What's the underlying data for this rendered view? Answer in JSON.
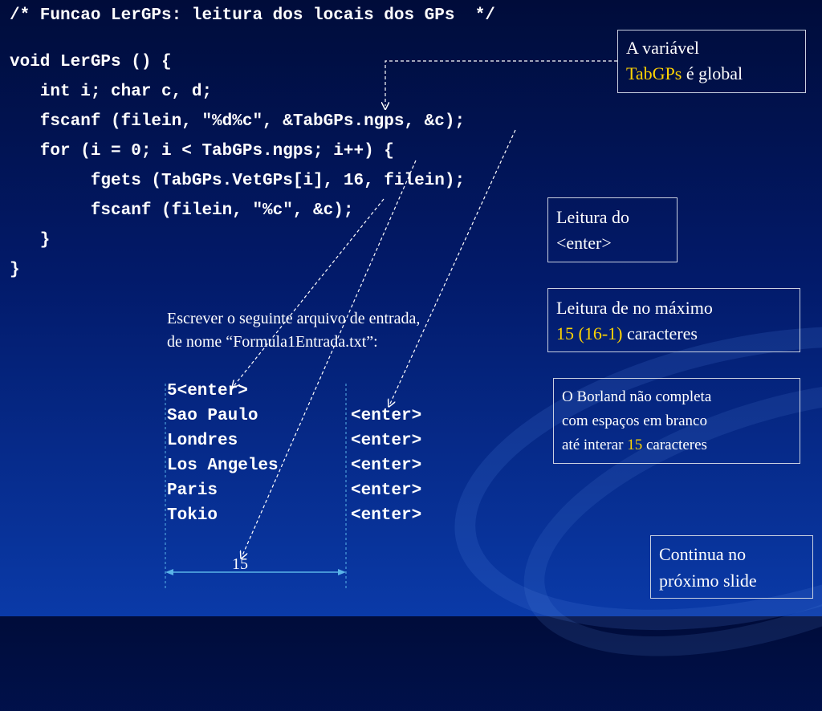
{
  "code": {
    "comment": "/* Funcao LerGPs: leitura dos locais dos GPs  */",
    "lines": [
      "void LerGPs () {",
      "   int i; char c, d;",
      "   fscanf (filein, \"%d%c\", &TabGPs.ngps, &c);",
      "   for (i = 0; i < TabGPs.ngps; i++) {",
      "        fgets (TabGPs.VetGPs[i], 16, filein);",
      "        fscanf (filein, \"%c\", &c);",
      "   }",
      "}"
    ]
  },
  "notes": {
    "global": {
      "line1": "A variável",
      "highlight": "TabGPs",
      "rest": " é global"
    },
    "enter": {
      "line1": "Leitura do",
      "line2": "<enter>"
    },
    "max": {
      "line1": "Leitura de no máximo",
      "highlight": "15 (16-1)",
      "rest": " caracteres"
    },
    "borland": {
      "line1": "O Borland não completa",
      "line2": "com espaços em branco",
      "line3_prefix": "até interar ",
      "highlight": "15",
      "line3_suffix": " caracteres"
    },
    "continue": {
      "line1": "Continua no",
      "line2": "próximo slide"
    }
  },
  "instructions": {
    "line1": "Escrever o seguinte arquivo de entrada,",
    "line2": "de nome “Formula1Entrada.txt”:"
  },
  "file": {
    "first": "5<enter>",
    "rows": [
      {
        "city": "Sao Paulo",
        "enter": "<enter>"
      },
      {
        "city": "Londres",
        "enter": "<enter>"
      },
      {
        "city": "Los Angeles",
        "enter": "<enter>"
      },
      {
        "city": "Paris",
        "enter": "<enter>"
      },
      {
        "city": "Tokio",
        "enter": "<enter>"
      }
    ]
  },
  "width_label": "15",
  "colors": {
    "highlight": "#ffd400",
    "measure": "#5ab4e8",
    "background": "#021a6a"
  }
}
